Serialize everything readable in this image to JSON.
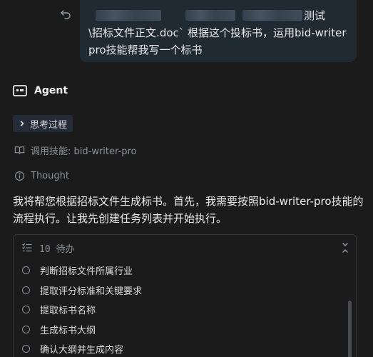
{
  "user_message": {
    "line1_visible": "测试",
    "line2": "\\招标文件正文.doc` 根据这个投标书，运用bid-writer-",
    "line3": "pro技能帮我写一个标书"
  },
  "agent": {
    "title": "Agent"
  },
  "thinking": {
    "label": "思考过程"
  },
  "skill": {
    "label": "调用技能: bid-writer-pro"
  },
  "thought": {
    "label": "Thought"
  },
  "paragraph": {
    "text": "我将帮您根据招标文件生成标书。首先，我需要按照bid-writer-pro技能的流程执行。让我先创建任务列表并开始执行。"
  },
  "todo": {
    "header": "10 待办",
    "items": [
      "判断招标文件所属行业",
      "提取评分标准和关键要求",
      "提取标书名称",
      "生成标书大纲",
      "确认大纲并生成内容"
    ]
  },
  "icons": {
    "undo": "undo-icon",
    "agent": "agent-terminal-icon",
    "chevron": "chevron-right-icon",
    "skill": "book-icon",
    "thought": "info-icon",
    "todo_list": "checklist-icon",
    "collapse": "collapse-icon"
  },
  "colors": {
    "background": "#1b1b1c",
    "bubble": "#1f2a33",
    "chip": "#232c36",
    "muted": "#8c9196"
  }
}
